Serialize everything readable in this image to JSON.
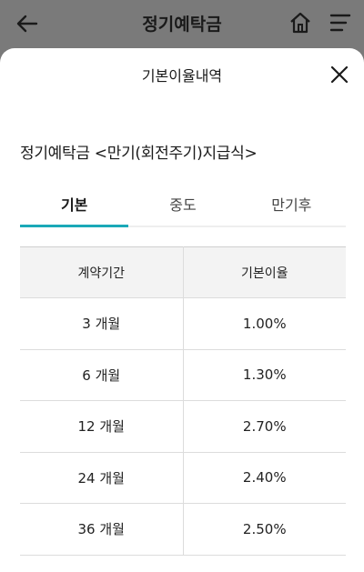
{
  "app_bar": {
    "title": "정기예탁금",
    "icons": [
      "back-arrow-icon",
      "home-icon",
      "menu-icon"
    ]
  },
  "sheet": {
    "title": "기본이율내역",
    "product_name": "정기예탁금 <만기(회전주기)지급식>",
    "tabs": [
      {
        "label": "기본",
        "active": true
      },
      {
        "label": "중도",
        "active": false
      },
      {
        "label": "만기후",
        "active": false
      }
    ],
    "table": {
      "headers": [
        "계약기간",
        "기본이율"
      ],
      "rows": [
        [
          "3 개월",
          "1.00%"
        ],
        [
          "6 개월",
          "1.30%"
        ],
        [
          "12 개월",
          "2.70%"
        ],
        [
          "24 개월",
          "2.40%"
        ],
        [
          "36 개월",
          "2.50%"
        ]
      ]
    }
  },
  "colors": {
    "accent": "#1aa9b8",
    "overlay": "#7a7a7a",
    "header_bg": "#f3f3f3"
  }
}
